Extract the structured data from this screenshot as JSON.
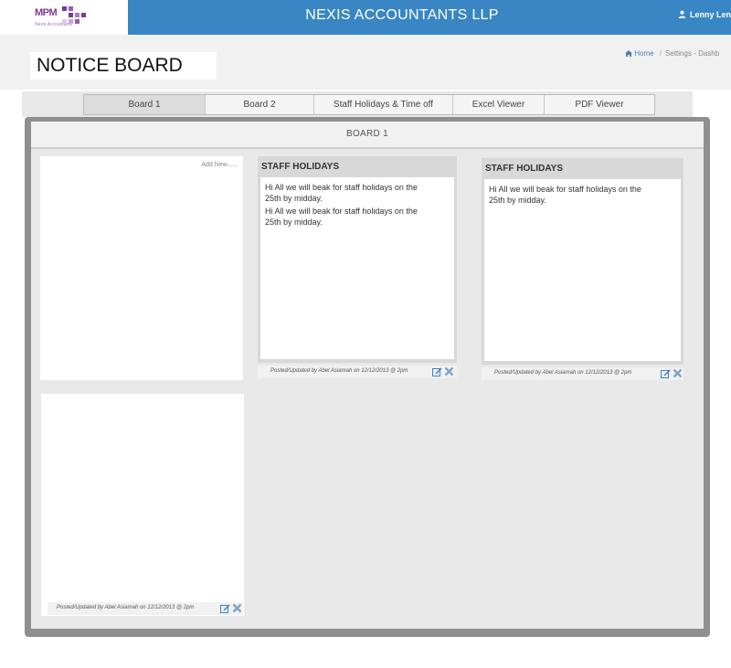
{
  "header": {
    "logo_text": "MPM",
    "logo_subtext": "Nexis Accountants",
    "app_title": "NEXIS ACCOUNTANTS LLP",
    "user_name": "Lenny Len"
  },
  "page": {
    "title": "NOTICE BOARD",
    "breadcrumb": {
      "home": "Home",
      "separator": "/",
      "current": "Settings - Dashb"
    }
  },
  "tabs": [
    {
      "label": "Board 1",
      "active": true
    },
    {
      "label": "Board 2",
      "active": false
    },
    {
      "label": "Staff Holidays & Time off",
      "active": false
    },
    {
      "label": "Excel Viewer",
      "active": false
    },
    {
      "label": "PDF Viewer",
      "active": false
    }
  ],
  "board": {
    "title": "BOARD 1",
    "add_new_label": "Add New......",
    "notes": [
      {
        "title": "STAFF HOLIDAYS",
        "messages": [
          "Hi All we will beak for staff holidays on the 25th by midday.",
          "Hi All we will beak for staff holidays on the 25th by midday."
        ],
        "footer": "Posted/Updated by Abel Asiamah on 12/12/2013 @ 2pm"
      },
      {
        "title": "STAFF HOLIDAYS",
        "messages": [
          "Hi All we will beak for staff holidays on the 25th by midday."
        ],
        "footer": "Posted/Updated by Abel Asiamah on 12/12/2013 @ 2pm"
      }
    ],
    "empty_panel_footer": "Posted/Updated by Abel Asiamah on 12/12/2013 @ 2pm"
  },
  "colors": {
    "header_blue": "#3a86c4",
    "edit_icon": "#3b7fc4",
    "delete_icon": "#7fa3c8"
  },
  "icons": {
    "user": "user-icon",
    "home": "home-icon",
    "edit": "edit-icon",
    "delete": "delete-icon"
  }
}
